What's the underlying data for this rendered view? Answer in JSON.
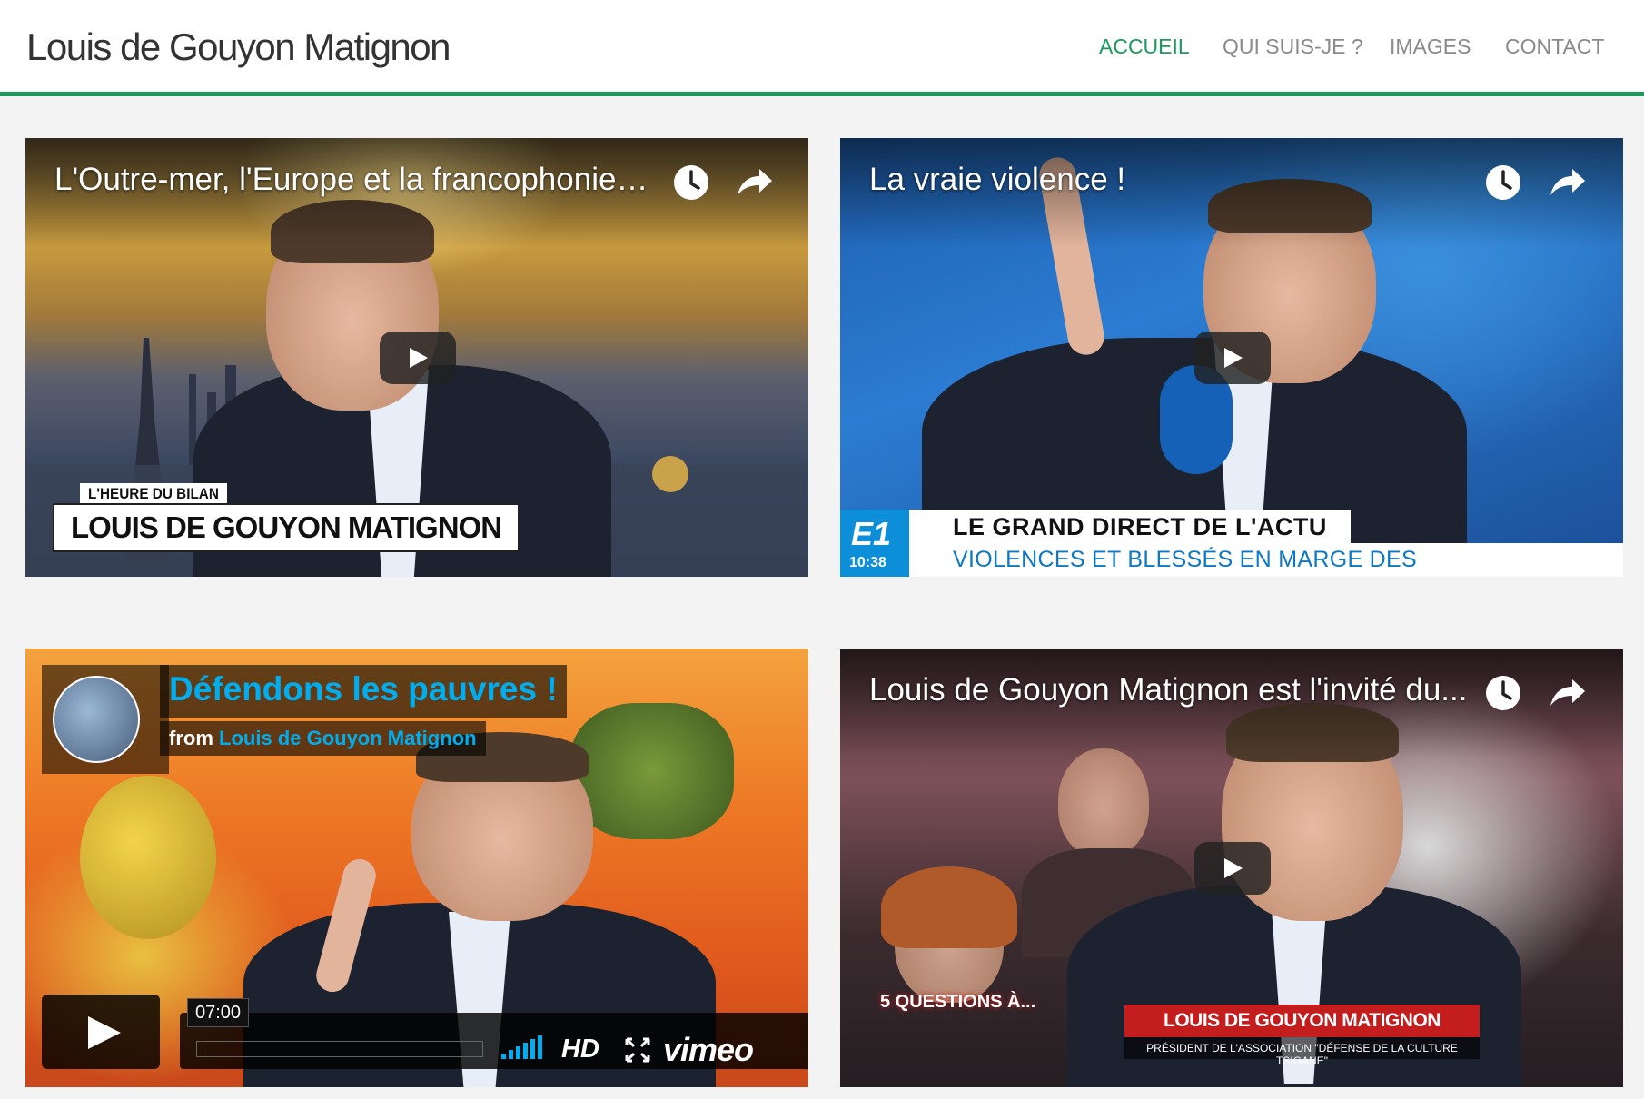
{
  "site": {
    "title": "Louis de Gouyon Matignon",
    "accent_color": "#1a9a5c"
  },
  "nav": {
    "items": [
      {
        "label": "ACCUEIL",
        "active": true
      },
      {
        "label": "QUI SUIS-JE ?",
        "active": false
      },
      {
        "label": "IMAGES",
        "active": false
      },
      {
        "label": "CONTACT",
        "active": false
      }
    ]
  },
  "videos": [
    {
      "platform": "youtube",
      "title": "L'Outre-mer, l'Europe et la francophonie -...",
      "icons": [
        "clock-icon",
        "share-icon",
        "play-icon"
      ],
      "caption_small": "L'HEURE DU BILAN",
      "caption_big": "LOUIS DE GOUYON MATIGNON"
    },
    {
      "platform": "youtube",
      "title": "La vraie violence !",
      "icons": [
        "clock-icon",
        "share-icon",
        "play-icon"
      ],
      "channel_logo": "E1",
      "channel_time": "10:38",
      "caption_top": "LE GRAND DIRECT DE L'ACTU",
      "caption_bottom": "VIOLENCES ET BLESSÉS EN MARGE DES MANIFESTATIONS"
    },
    {
      "platform": "vimeo",
      "title": "Défendons les pauvres !",
      "from_label": "from",
      "author": "Louis de Gouyon Matignon",
      "duration": "07:00",
      "hd_label": "HD",
      "logo": "vimeo"
    },
    {
      "platform": "youtube",
      "title": "Louis de Gouyon Matignon est l'invité du...",
      "icons": [
        "clock-icon",
        "share-icon",
        "play-icon"
      ],
      "show_logo": "5 QUESTIONS À...",
      "caption_name": "LOUIS DE GOUYON MATIGNON",
      "caption_sub": "PRÉSIDENT DE L'ASSOCIATION \"DÉFENSE DE LA CULTURE TSIGANE\""
    }
  ]
}
